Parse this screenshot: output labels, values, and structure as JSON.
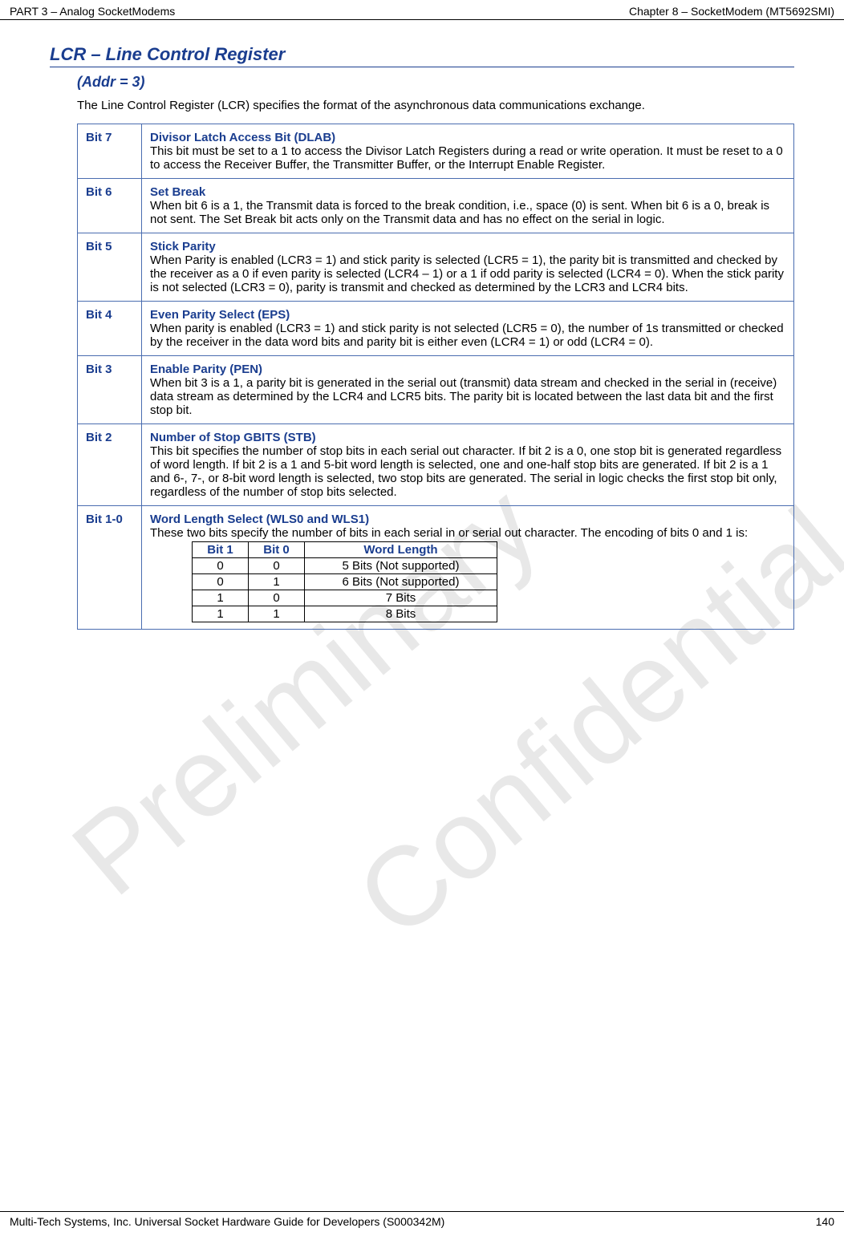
{
  "header": {
    "left": "PART 3 – Analog SocketModems",
    "right": "Chapter 8 – SocketModem (MT5692SMI)"
  },
  "title": "LCR – Line Control Register",
  "subtitle": "(Addr = 3)",
  "intro": "The Line Control Register (LCR) specifies the format of the asynchronous data communications exchange.",
  "rows": [
    {
      "bit": "Bit 7",
      "name": "Divisor Latch Access Bit (DLAB)",
      "desc": "This bit must be set to a 1 to access the Divisor Latch Registers during a read or write operation. It must be reset to a 0 to access the Receiver Buffer, the Transmitter Buffer, or the Interrupt Enable Register."
    },
    {
      "bit": "Bit 6",
      "name": "Set Break",
      "desc": "When bit 6 is a 1, the Transmit data is forced to the break condition, i.e., space (0) is sent. When bit 6 is a 0, break is not sent. The Set Break bit acts only on the Transmit data and has no effect on the serial in logic."
    },
    {
      "bit": "Bit 5",
      "name": "Stick Parity",
      "desc": "When Parity is enabled (LCR3 = 1) and stick parity is selected (LCR5 = 1), the parity bit is transmitted and checked by the receiver as a 0 if even parity is selected (LCR4 – 1) or a 1 if odd parity is selected (LCR4 = 0). When the stick parity is not selected (LCR3 = 0), parity is transmit and checked as determined by the LCR3 and LCR4 bits."
    },
    {
      "bit": "Bit 4",
      "name": "Even Parity Select (EPS)",
      "desc": "When parity is enabled (LCR3 = 1) and stick parity is not selected (LCR5 = 0), the number of 1s transmitted or checked by the receiver in the data word bits and parity bit is either even (LCR4 = 1) or odd (LCR4 = 0)."
    },
    {
      "bit": "Bit 3",
      "name": "Enable Parity (PEN)",
      "desc": "When bit 3 is a 1, a parity bit is generated in the serial out (transmit) data stream and checked in the serial in (receive) data stream as determined by the LCR4 and LCR5 bits. The parity bit is located between the last data bit and the first stop bit."
    },
    {
      "bit": "Bit 2",
      "name": "Number of Stop GBITS (STB)",
      "desc": "This bit specifies the number of stop bits in each serial out character. If bit 2 is a 0, one stop bit is generated regardless of word length. If bit 2 is a 1 and 5-bit word length is selected, one and one-half stop bits are generated. If bit 2 is a 1 and 6-, 7-, or 8-bit word length is selected, two stop bits are generated. The serial in logic checks the first stop bit only, regardless of the number of stop bits selected."
    },
    {
      "bit": "Bit 1-0",
      "name": "Word Length Select (WLS0 and WLS1)",
      "desc": "These two bits specify the number of bits in each serial in or serial out character. The encoding of bits 0 and 1 is:"
    }
  ],
  "inner_table": {
    "headers": [
      "Bit 1",
      "Bit 0",
      "Word Length"
    ],
    "rows": [
      [
        "0",
        "0",
        "5 Bits (Not supported)"
      ],
      [
        "0",
        "1",
        "6 Bits (Not supported)"
      ],
      [
        "1",
        "0",
        "7 Bits"
      ],
      [
        "1",
        "1",
        "8 Bits"
      ]
    ]
  },
  "footer": {
    "left": "Multi-Tech Systems, Inc. Universal Socket Hardware Guide for Developers (S000342M)",
    "right": "140"
  },
  "watermarks": {
    "preliminary": "Preliminary",
    "confidential": "Confidential"
  }
}
